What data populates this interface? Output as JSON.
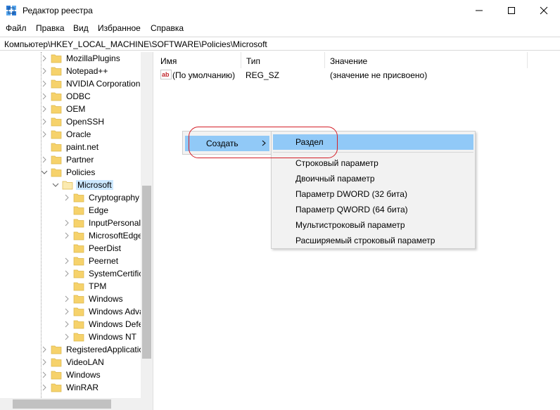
{
  "window": {
    "title": "Редактор реестра"
  },
  "menu": [
    "Файл",
    "Правка",
    "Вид",
    "Избранное",
    "Справка"
  ],
  "address": "Компьютер\\HKEY_LOCAL_MACHINE\\SOFTWARE\\Policies\\Microsoft",
  "tree": {
    "items": [
      "MozillaPlugins",
      "Notepad++",
      "NVIDIA Corporation",
      "ODBC",
      "OEM",
      "OpenSSH",
      "Oracle",
      "paint.net",
      "Partner",
      "Policies",
      "Microsoft",
      "Cryptography",
      "Edge",
      "InputPersonali",
      "MicrosoftEdge",
      "PeerDist",
      "Peernet",
      "SystemCertific",
      "TPM",
      "Windows",
      "Windows Adva",
      "Windows Defe",
      "Windows NT",
      "RegisteredApplicatio",
      "VideoLAN",
      "Windows",
      "WinRAR"
    ]
  },
  "list": {
    "columns": [
      "Имя",
      "Тип",
      "Значение"
    ],
    "rows": [
      {
        "name": "(По умолчанию)",
        "type": "REG_SZ",
        "value": "(значение не присвоено)"
      }
    ]
  },
  "context_menu": {
    "create_label": "Создать"
  },
  "submenu": {
    "items": [
      "Раздел",
      "Строковый параметр",
      "Двоичный параметр",
      "Параметр DWORD (32 бита)",
      "Параметр QWORD (64 бита)",
      "Мультистроковый параметр",
      "Расширяемый строковый параметр"
    ]
  },
  "colors": {
    "highlight": "#91c9f7",
    "annotation": "#d41f28",
    "folder": "#f6d26b"
  }
}
